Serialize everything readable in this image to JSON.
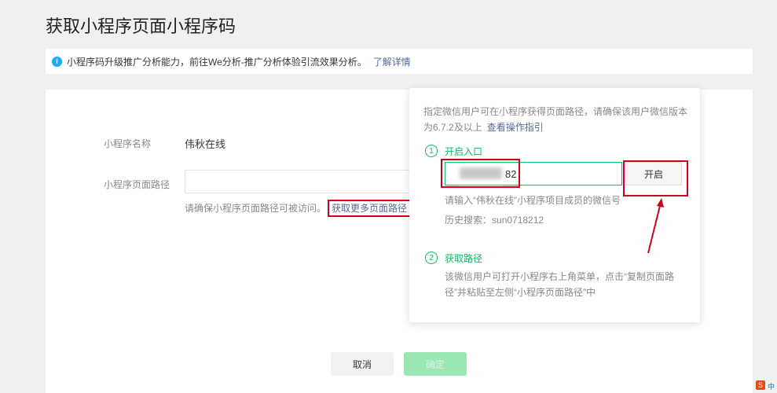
{
  "page": {
    "title": "获取小程序页面小程序码"
  },
  "notice": {
    "text": "小程序码升级推广分析能力，前往We分析-推广分析体验引流效果分析。",
    "link": "了解详情"
  },
  "form": {
    "name_label": "小程序名称",
    "name_value": "伟秋在线",
    "path_label": "小程序页面路径",
    "path_value": "",
    "path_hint": "请确保小程序页面路径可被访问。",
    "more_paths_link": "获取更多页面路径"
  },
  "buttons": {
    "cancel": "取消",
    "confirm": "确定"
  },
  "popover": {
    "description": "指定微信用户可在小程序获得页面路径，请确保该用户微信版本为6.7.2及以上",
    "guide_link": "查看操作指引",
    "step1": {
      "number": "1",
      "title": "开启入口",
      "input_value": "82",
      "open_button": "开启",
      "hint": "请输入“伟秋在线”小程序项目成员的微信号",
      "history_label": "历史搜索：",
      "history_value": "sun0718212"
    },
    "step2": {
      "number": "2",
      "title": "获取路径",
      "description": "该微信用户可打开小程序右上角菜单，点击“复制页面路径”并粘贴至左侧“小程序页面路径”中"
    }
  },
  "corner": {
    "badge": "S",
    "text": "中"
  },
  "colors": {
    "accent": "#07c160",
    "link": "#576b95",
    "highlight": "#d0021b"
  }
}
